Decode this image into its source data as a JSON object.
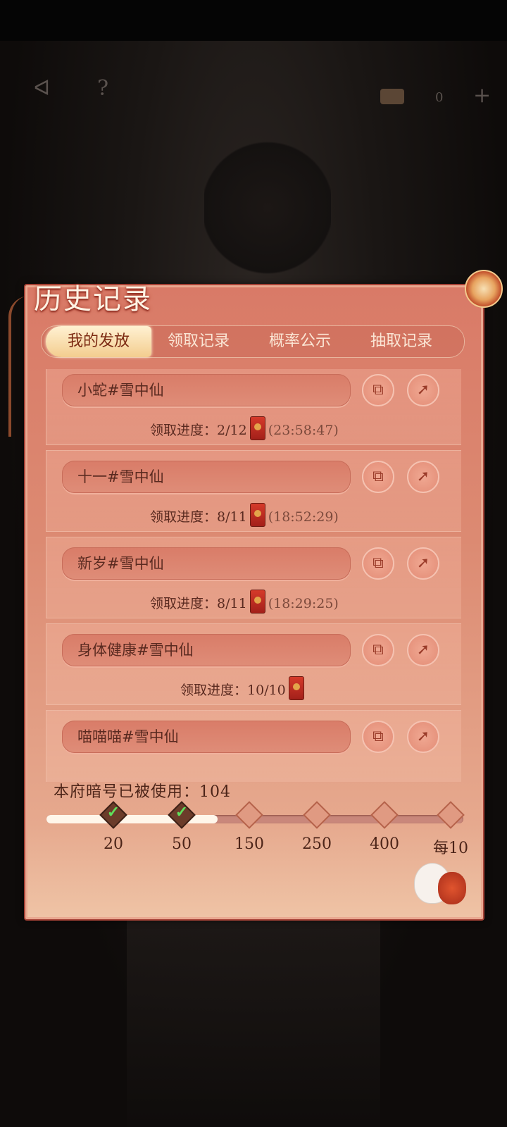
{
  "header": {
    "coin_count": "0",
    "icons": [
      "back-icon",
      "help-icon",
      "chest-icon",
      "plus-icon"
    ]
  },
  "panel": {
    "title": "历史记录",
    "tabs": [
      {
        "label": "我的发放",
        "active": true
      },
      {
        "label": "领取记录",
        "active": false
      },
      {
        "label": "概率公示",
        "active": false
      },
      {
        "label": "抽取记录",
        "active": false
      }
    ],
    "records": [
      {
        "name": "小蛇#雪中仙",
        "progress_label": "领取进度：",
        "progress": "2/12",
        "time": "(23:58:47)"
      },
      {
        "name": "十一#雪中仙",
        "progress_label": "领取进度：",
        "progress": "8/11",
        "time": "(18:52:29)"
      },
      {
        "name": "新岁#雪中仙",
        "progress_label": "领取进度：",
        "progress": "8/11",
        "time": "(18:29:25)"
      },
      {
        "name": "身体健康#雪中仙",
        "progress_label": "领取进度：",
        "progress": "10/10",
        "time": ""
      },
      {
        "name": "喵喵喵#雪中仙",
        "progress_label": "",
        "progress": "",
        "time": ""
      }
    ],
    "usage": {
      "label": "本府暗号已被使用：",
      "count": "104",
      "fill_fraction": 0.41,
      "milestones": [
        {
          "label": "20",
          "done": true
        },
        {
          "label": "50",
          "done": true
        },
        {
          "label": "150",
          "done": false
        },
        {
          "label": "250",
          "done": false
        },
        {
          "label": "400",
          "done": false
        },
        {
          "label": "每10",
          "done": false
        }
      ]
    }
  },
  "colors": {
    "panel": "#dc8a72",
    "accent_gold": "#f3cd8f",
    "envelope_red": "#c8301f",
    "check_green": "#5fe05b"
  }
}
